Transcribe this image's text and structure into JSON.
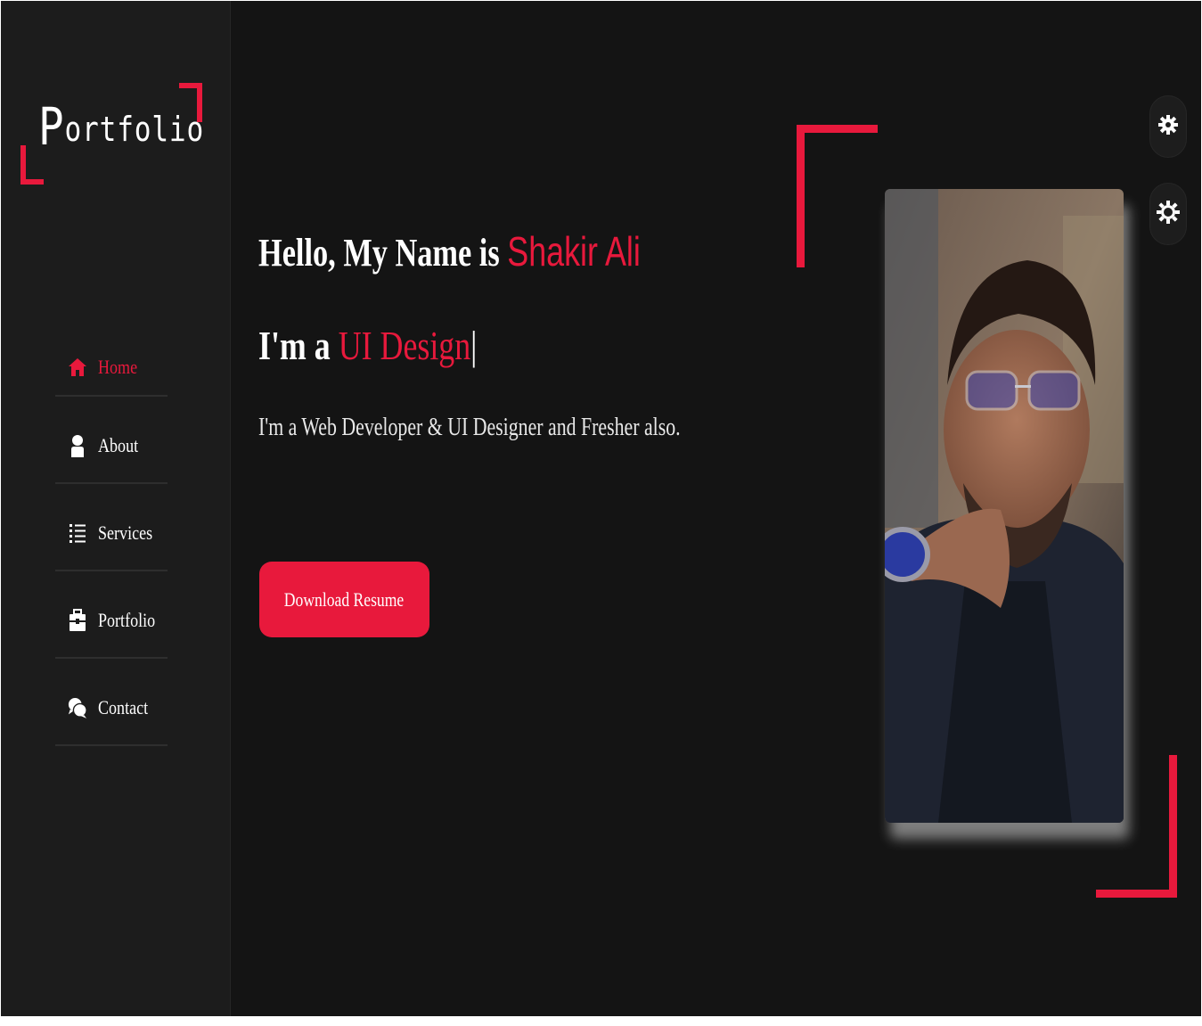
{
  "sidebar": {
    "logo_first": "P",
    "logo_rest": "ortfolio",
    "items": [
      {
        "label": "Home",
        "icon": "home-icon",
        "active": true
      },
      {
        "label": "About",
        "icon": "user-icon",
        "active": false
      },
      {
        "label": "Services",
        "icon": "list-icon",
        "active": false
      },
      {
        "label": "Portfolio",
        "icon": "briefcase-icon",
        "active": false
      },
      {
        "label": "Contact",
        "icon": "chat-icon",
        "active": false
      }
    ]
  },
  "hero": {
    "greeting": "Hello, My Name is ",
    "name": "Shakir Ali",
    "role_prefix": "I'm a ",
    "role_typed": "UI Design",
    "cursor": "|",
    "description": "I'm a Web Developer & UI Designer and Fresher also.",
    "button_label": "Download Resume"
  },
  "settings": {
    "buttons": [
      "gear-icon",
      "sun-icon"
    ]
  },
  "colors": {
    "accent": "#e8193c",
    "background": "#141414",
    "sidebar": "#1c1c1c",
    "text": "#ffffff"
  }
}
